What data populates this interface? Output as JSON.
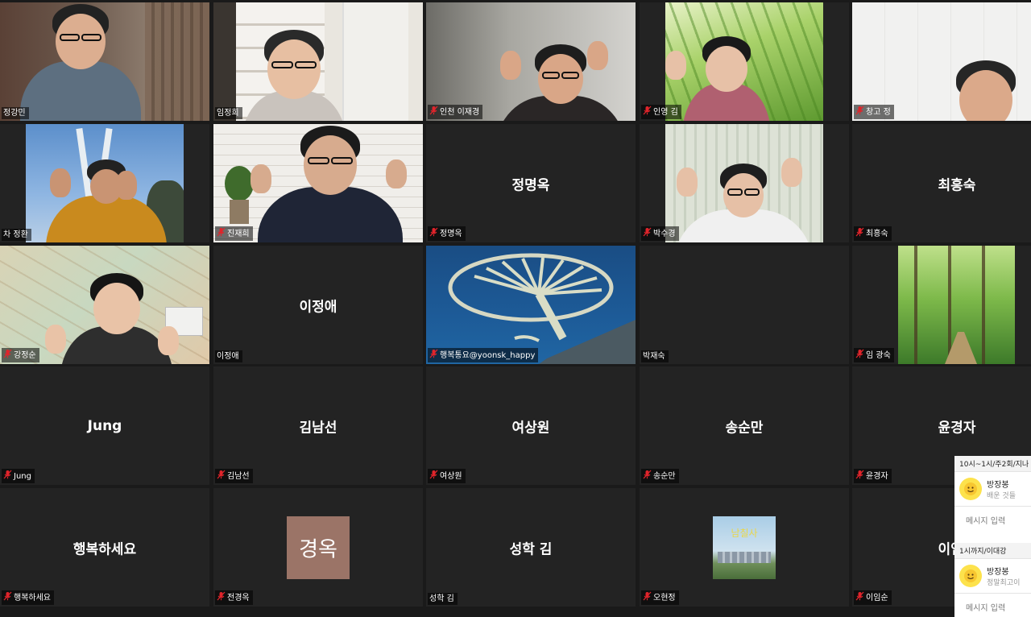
{
  "tiles": [
    {
      "id": "t0",
      "name": "정강민",
      "muted": false,
      "kind": "video",
      "scene": "office"
    },
    {
      "id": "t1",
      "name": "임정희",
      "muted": false,
      "kind": "video",
      "scene": "bookshelf",
      "active": true
    },
    {
      "id": "t2",
      "name": "인천 이재경",
      "muted": true,
      "kind": "video",
      "scene": "wave-man"
    },
    {
      "id": "t3",
      "name": "인영 김",
      "muted": true,
      "kind": "video",
      "scene": "grass-woman"
    },
    {
      "id": "t4",
      "name": "창고 정",
      "muted": true,
      "kind": "video",
      "scene": "ceiling-man"
    },
    {
      "id": "t5",
      "name": "차 정환",
      "muted": false,
      "kind": "video",
      "scene": "tower-man"
    },
    {
      "id": "t6",
      "name": "진재희",
      "muted": true,
      "kind": "video",
      "scene": "brick-man"
    },
    {
      "id": "t7",
      "name": "정명옥",
      "muted": true,
      "kind": "name",
      "center": "정명옥"
    },
    {
      "id": "t8",
      "name": "박수경",
      "muted": true,
      "kind": "video",
      "scene": "curtain-woman"
    },
    {
      "id": "t9",
      "name": "최흥숙",
      "muted": true,
      "kind": "name",
      "center": "최흥숙"
    },
    {
      "id": "t10",
      "name": "강정순",
      "muted": true,
      "kind": "video",
      "scene": "map-woman"
    },
    {
      "id": "t11",
      "name": "이정애",
      "muted": false,
      "kind": "name",
      "center": "이정애"
    },
    {
      "id": "t12",
      "name": "행복통요@yoonsk_happy",
      "muted": true,
      "kind": "video",
      "scene": "palm-island"
    },
    {
      "id": "t13",
      "name": "박재숙",
      "muted": false,
      "kind": "blank"
    },
    {
      "id": "t14",
      "name": "임 광숙",
      "muted": true,
      "kind": "video",
      "scene": "forest"
    },
    {
      "id": "t15",
      "name": "Jung",
      "muted": true,
      "kind": "name",
      "center": "Jung"
    },
    {
      "id": "t16",
      "name": "김남선",
      "muted": true,
      "kind": "name",
      "center": "김남선"
    },
    {
      "id": "t17",
      "name": "여상원",
      "muted": true,
      "kind": "name",
      "center": "여상원"
    },
    {
      "id": "t18",
      "name": "송순만",
      "muted": true,
      "kind": "name",
      "center": "송순만"
    },
    {
      "id": "t19",
      "name": "윤경자",
      "muted": true,
      "kind": "name",
      "center": "윤경자"
    },
    {
      "id": "t20",
      "name": "행복하세요",
      "muted": true,
      "kind": "name",
      "center": "행복하세요"
    },
    {
      "id": "t21",
      "name": "전경옥",
      "muted": true,
      "kind": "avatar",
      "avatar_text": "경옥",
      "avatar_color": "#9b7467"
    },
    {
      "id": "t22",
      "name": "성학 김",
      "muted": false,
      "kind": "name",
      "center": "성학 김"
    },
    {
      "id": "t23",
      "name": "오현정",
      "muted": true,
      "kind": "avatar-photo",
      "avatar_text": "남칠사"
    },
    {
      "id": "t24",
      "name": "이임순",
      "muted": true,
      "kind": "name",
      "center": "이임순"
    }
  ],
  "chats": [
    {
      "header": "10시~1시/주2회/지나",
      "sender": "방장봉",
      "message": "배운 것들",
      "input_placeholder": "메시지 입력"
    },
    {
      "header": "1시까지/이대강",
      "sender": "방장봉",
      "message": "정말최고이",
      "input_placeholder": "메시지 입력"
    }
  ],
  "colors": {
    "tile_bg": "#232323",
    "page_bg": "#1a1a1a",
    "active_border": "#d6e04a",
    "mute_red": "#e0242b",
    "chat_avatar": "#fde24c"
  }
}
